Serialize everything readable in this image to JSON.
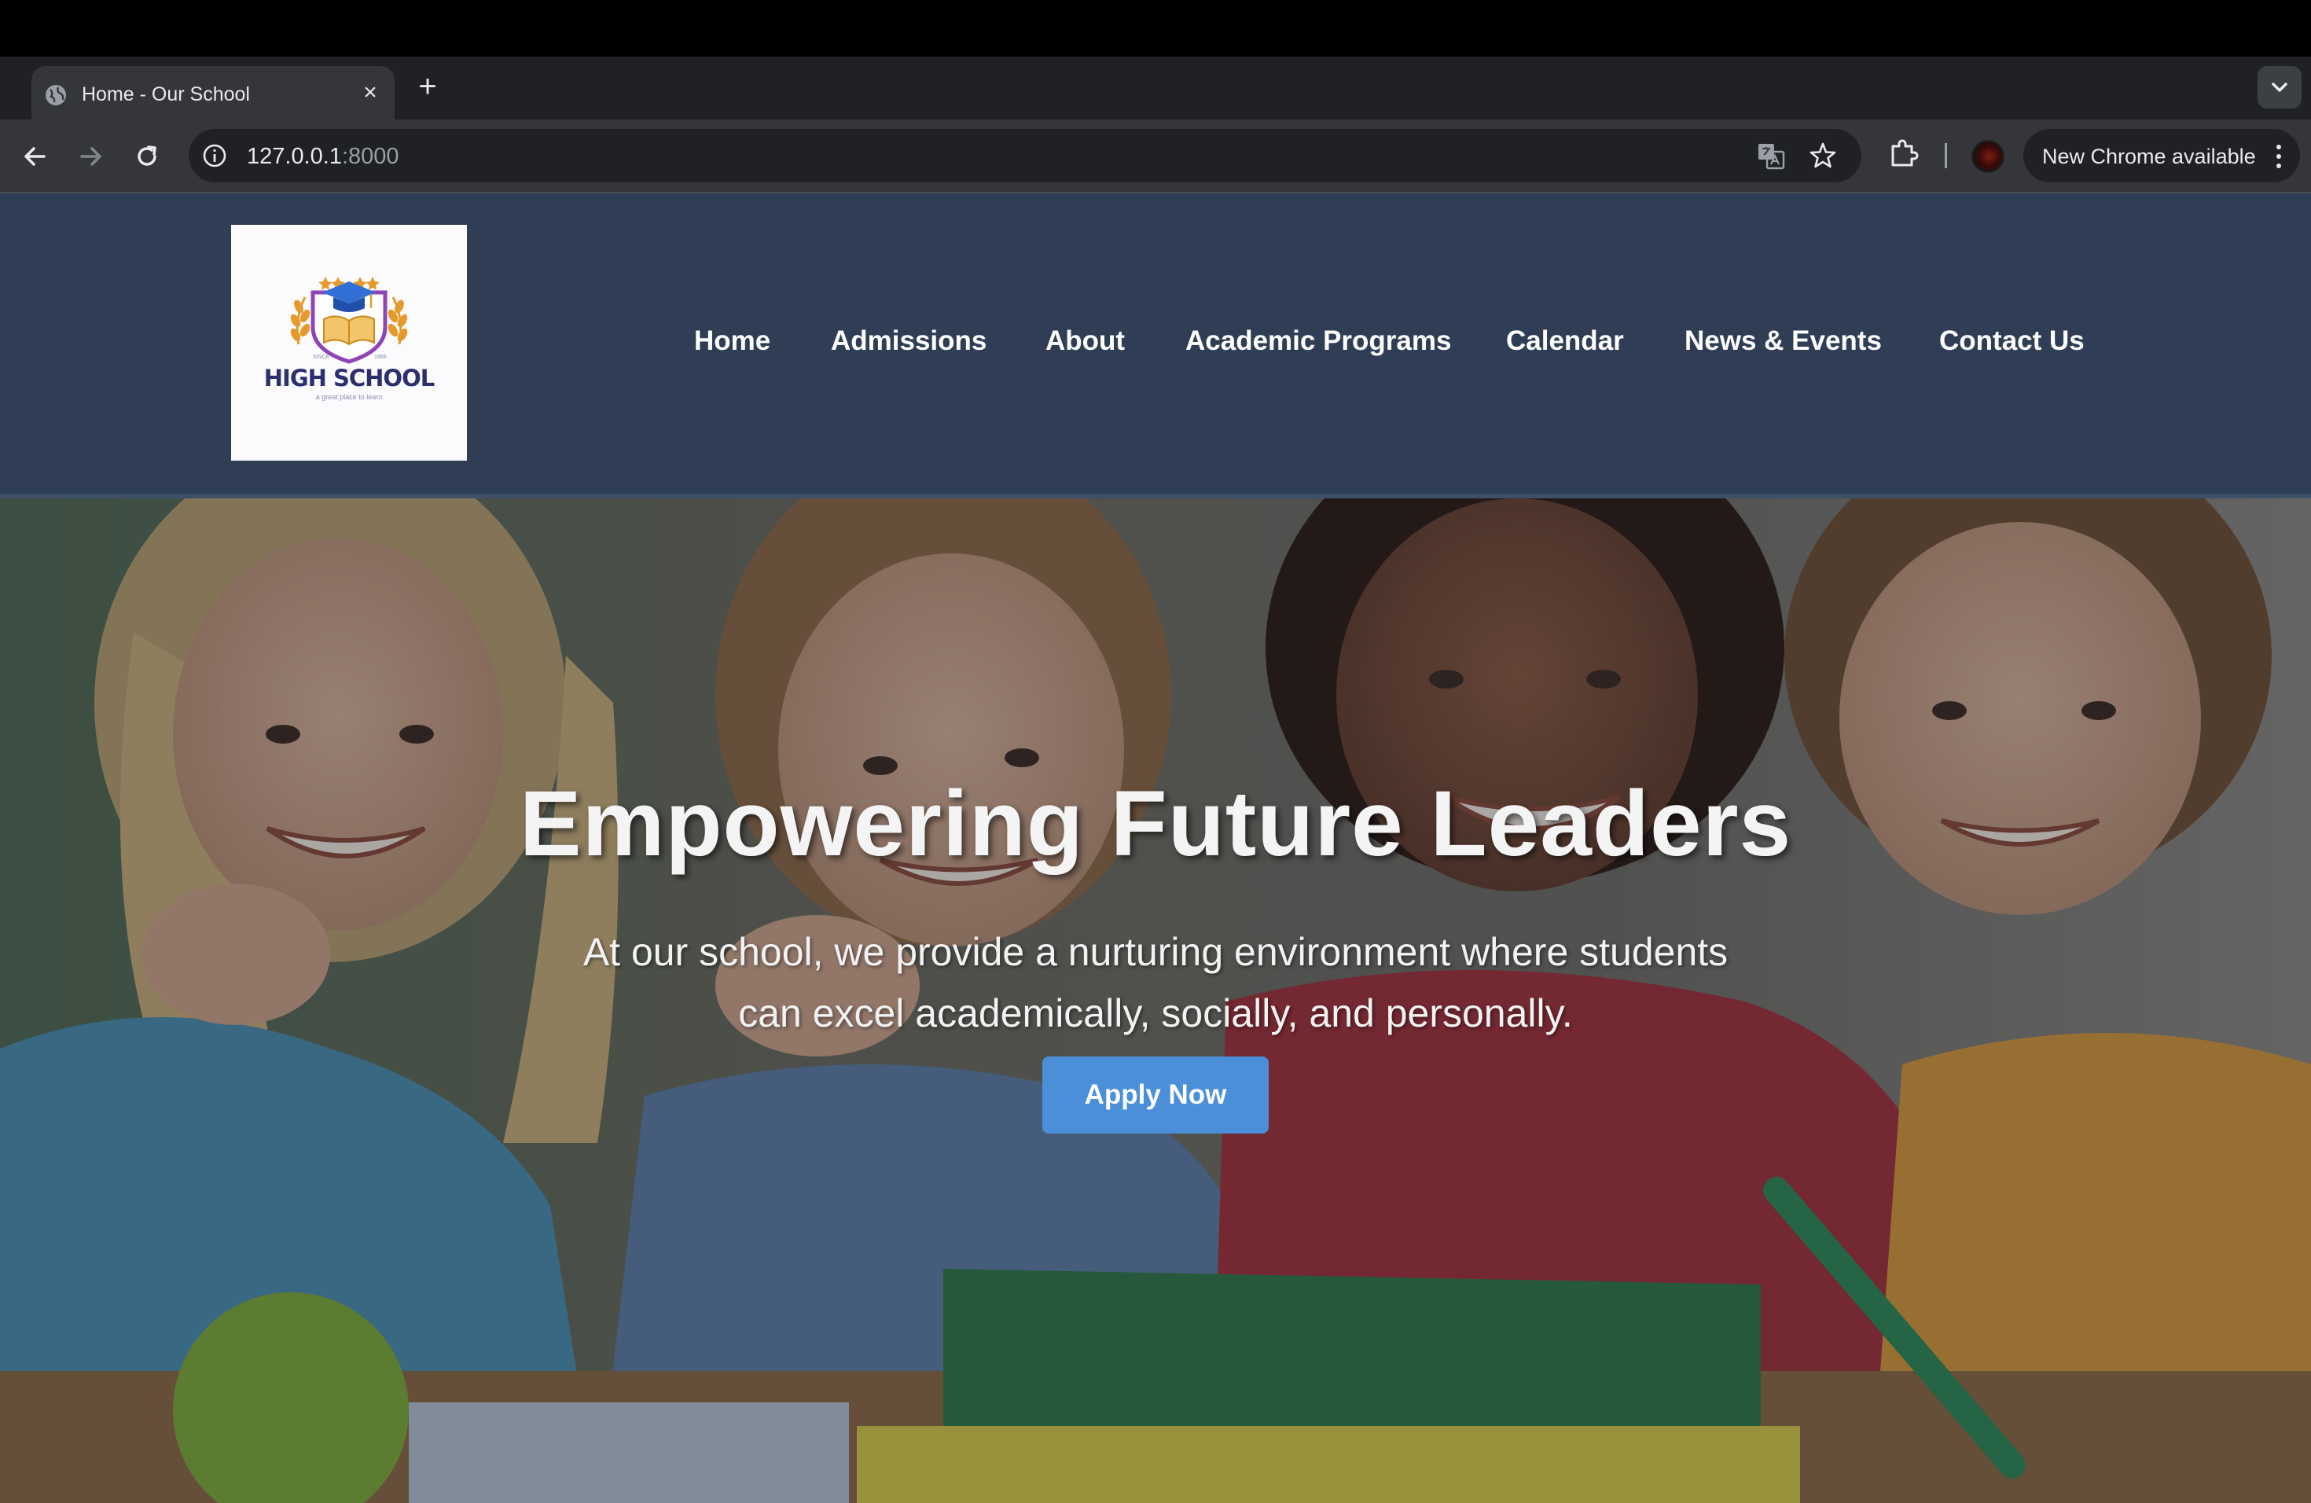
{
  "browser": {
    "tab_title": "Home - Our School",
    "new_tab_label": "+",
    "close_tab_label": "×",
    "url_host": "127.0.0.1",
    "url_port": ":8000",
    "update_label": "New Chrome available"
  },
  "site": {
    "logo": {
      "name": "HIGH SCHOOL",
      "tagline": "a great place to learn"
    },
    "nav": [
      "Home",
      "Admissions",
      "About",
      "Academic Programs",
      "Calendar",
      "News & Events",
      "Contact Us"
    ],
    "hero": {
      "title": "Empowering Future Leaders",
      "text": "At our school, we provide a nurturing environment where students can excel academically, socially, and personally.",
      "cta_label": "Apply Now"
    }
  },
  "colors": {
    "header_bg": "#2f3e55",
    "cta_bg": "#4a8fd8",
    "logo_text": "#2c2f6e"
  }
}
